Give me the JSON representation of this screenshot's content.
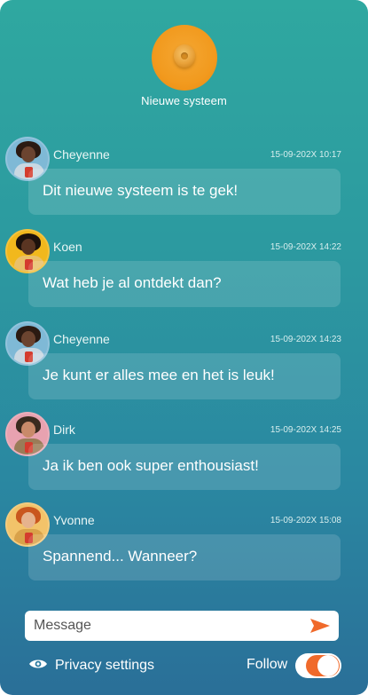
{
  "header": {
    "title": "Nieuwe systeem"
  },
  "messages": [
    {
      "name": "Cheyenne",
      "time": "15-09-202X 10:17",
      "text": "Dit nieuwe systeem is te gek!"
    },
    {
      "name": "Koen",
      "time": "15-09-202X 14:22",
      "text": "Wat heb je al ontdekt dan?"
    },
    {
      "name": "Cheyenne",
      "time": "15-09-202X 14:23",
      "text": "Je kunt er alles mee en het is leuk!"
    },
    {
      "name": "Dirk",
      "time": "15-09-202X 14:25",
      "text": "Ja ik ben ook super enthousiast!"
    },
    {
      "name": "Yvonne",
      "time": "15-09-202X 15:08",
      "text": "Spannend... Wanneer?"
    }
  ],
  "composer": {
    "placeholder": "Message",
    "send_icon": "send-icon"
  },
  "footer": {
    "privacy_label": "Privacy settings",
    "follow_label": "Follow",
    "follow_on": true
  },
  "colors": {
    "accent": "#f06a2b",
    "logo": "#f29a1e",
    "bg_top": "#2fa8a0",
    "bg_bottom": "#2a6f98"
  }
}
